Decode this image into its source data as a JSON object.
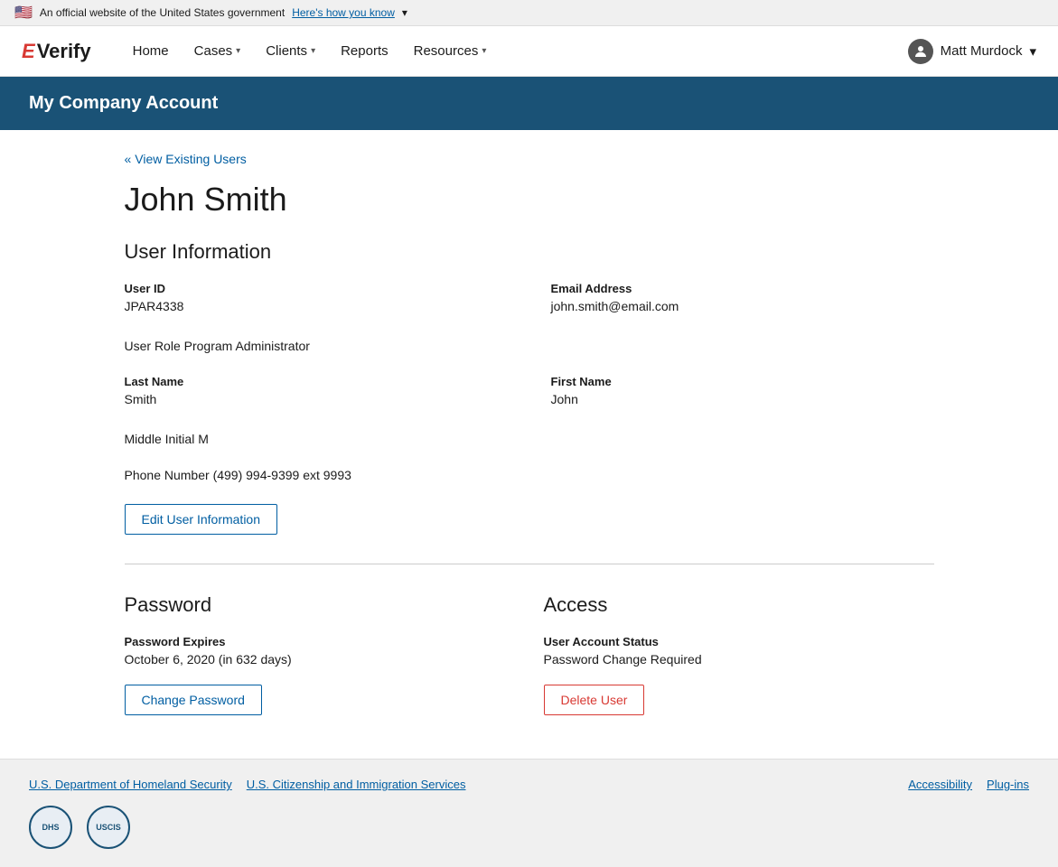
{
  "gov_banner": {
    "flag_emoji": "🇺🇸",
    "text": "An official website of the United States government",
    "link_text": "Here's how you know",
    "chevron": "▾"
  },
  "navbar": {
    "logo_e": "E",
    "logo_verify": "Verify",
    "nav_items": [
      {
        "label": "Home",
        "has_chevron": false
      },
      {
        "label": "Cases",
        "has_chevron": true
      },
      {
        "label": "Clients",
        "has_chevron": true
      },
      {
        "label": "Reports",
        "has_chevron": false
      },
      {
        "label": "Resources",
        "has_chevron": true
      }
    ],
    "user_name": "Matt Murdock",
    "user_chevron": "▾"
  },
  "page_header": {
    "title": "My Company Account"
  },
  "breadcrumb": {
    "arrow": "«",
    "label": "View Existing Users"
  },
  "user_name_title": "John Smith",
  "user_info_section": {
    "title": "User Information",
    "fields": [
      {
        "label": "User ID",
        "value": "JPAR4338",
        "col": 1
      },
      {
        "label": "Email Address",
        "value": "john.smith@email.com",
        "col": 2
      },
      {
        "label": "User Role",
        "value": "Program Administrator",
        "col": 1,
        "full_width": true
      },
      {
        "label": "Last Name",
        "value": "Smith",
        "col": 1
      },
      {
        "label": "First Name",
        "value": "John",
        "col": 2
      },
      {
        "label": "Middle Initial",
        "value": "M",
        "col": 1,
        "full_width": true
      },
      {
        "label": "Phone Number",
        "value": "(499) 994-9399 ext 9993",
        "col": 1,
        "full_width": true
      }
    ],
    "edit_button_label": "Edit User Information"
  },
  "password_section": {
    "title": "Password",
    "expires_label": "Password Expires",
    "expires_value": "October 6, 2020 (in 632 days)",
    "change_button_label": "Change Password"
  },
  "access_section": {
    "title": "Access",
    "status_label": "User Account Status",
    "status_value": "Password Change Required",
    "delete_button_label": "Delete User"
  },
  "footer": {
    "links_left": [
      {
        "label": "U.S. Department of Homeland Security"
      },
      {
        "label": "U.S. Citizenship and Immigration Services"
      }
    ],
    "links_right": [
      {
        "label": "Accessibility"
      },
      {
        "label": "Plug-ins"
      }
    ],
    "seal1_text": "DHS",
    "seal2_text": "USCIS"
  }
}
